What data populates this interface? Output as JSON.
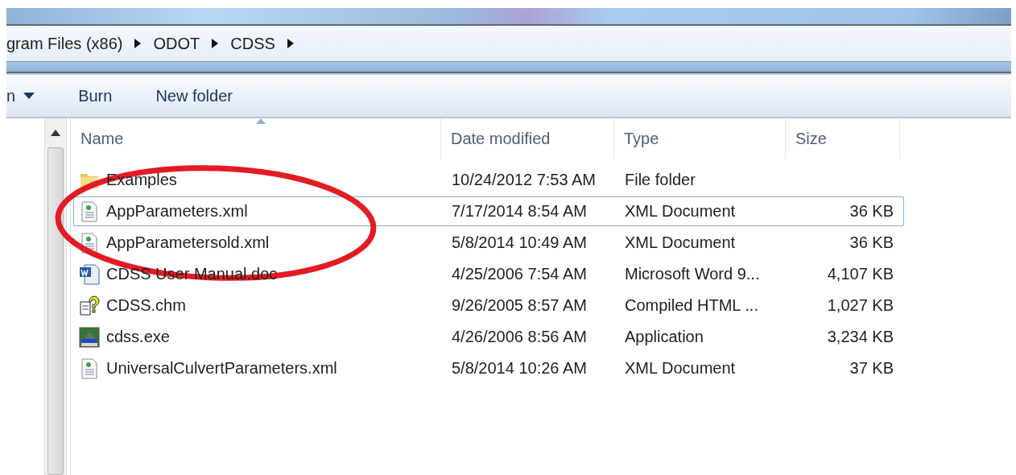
{
  "breadcrumb": [
    {
      "label": "gram Files (x86)"
    },
    {
      "label": "ODOT"
    },
    {
      "label": "CDSS"
    }
  ],
  "toolbar": [
    {
      "label": "n",
      "dropdown": true
    },
    {
      "label": "Burn",
      "dropdown": false
    },
    {
      "label": "New folder",
      "dropdown": false
    }
  ],
  "table": {
    "columns": [
      {
        "label": "Name",
        "sorted": true
      },
      {
        "label": "Date modified",
        "sorted": false
      },
      {
        "label": "Type",
        "sorted": false
      },
      {
        "label": "Size",
        "sorted": false
      }
    ],
    "rows": [
      {
        "kind": "folder",
        "name": "Examples",
        "date": "10/24/2012 7:53 AM",
        "type": "File folder",
        "focused": false
      },
      {
        "kind": "xml",
        "name": "AppParameters.xml",
        "date": "7/17/2014 8:54 AM",
        "type": "XML Document",
        "size": "36 KB",
        "focused": true
      },
      {
        "kind": "xml",
        "name": "AppParametersold.xml",
        "date": "5/8/2014 10:49 AM",
        "type": "XML Document",
        "size": "36 KB",
        "focused": false
      },
      {
        "kind": "word",
        "name": "CDSS User Manual.doc",
        "date": "4/25/2006 7:54 AM",
        "type": "Microsoft Word 9...",
        "size": "4,107 KB",
        "focused": false
      },
      {
        "kind": "help",
        "name": "CDSS.chm",
        "date": "9/26/2005 8:57 AM",
        "type": "Compiled HTML ...",
        "size": "1,027 KB",
        "focused": false
      },
      {
        "kind": "app",
        "name": "cdss.exe",
        "date": "4/26/2006 8:56 AM",
        "type": "Application",
        "size": "3,234 KB",
        "focused": false
      },
      {
        "kind": "xml",
        "name": "UniversalCulvertParameters.xml",
        "date": "5/8/2014 10:26 AM",
        "type": "XML Document",
        "size": "37 KB",
        "focused": false
      }
    ]
  },
  "annotation": {
    "kind": "ellipse",
    "color": "#e31b23"
  }
}
